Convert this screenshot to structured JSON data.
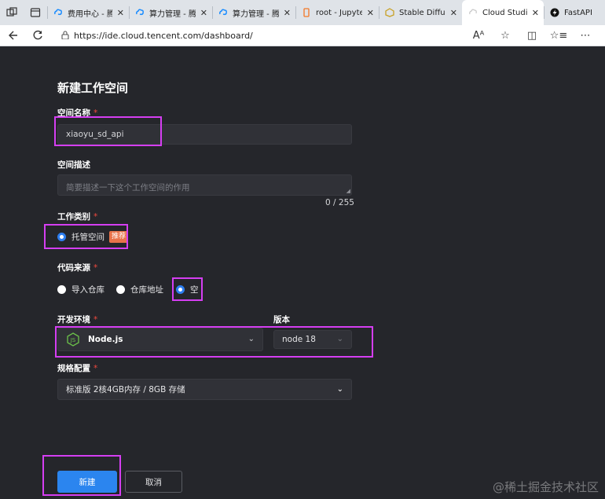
{
  "browser": {
    "tabs": [
      {
        "title": "费用中心 - 腾",
        "icon": "cloud-icon",
        "active": false
      },
      {
        "title": "算力管理 - 腾",
        "icon": "cloud-icon",
        "active": false
      },
      {
        "title": "算力管理 - 腾",
        "icon": "cloud-icon",
        "active": false
      },
      {
        "title": "root - Jupyte",
        "icon": "jupyter-icon",
        "active": false
      },
      {
        "title": "Stable Diffusi",
        "icon": "stable-diffusion-icon",
        "active": false
      },
      {
        "title": "Cloud Studio",
        "icon": "cloud-studio-icon",
        "active": true
      },
      {
        "title": "FastAPI - S",
        "icon": "fastapi-icon",
        "active": false
      }
    ],
    "url": "https://ide.cloud.tencent.com/dashboard/"
  },
  "form": {
    "title": "新建工作空间",
    "name": {
      "label": "空间名称",
      "value": "xiaoyu_sd_api"
    },
    "description": {
      "label": "空间描述",
      "placeholder": "简要描述一下这个工作空间的作用",
      "counter": "0 / 255"
    },
    "workspace_type": {
      "label": "工作类别",
      "option": "托管空间",
      "badge": "推荐"
    },
    "code_source": {
      "label": "代码来源",
      "options": [
        {
          "label": "导入仓库",
          "selected": false
        },
        {
          "label": "仓库地址",
          "selected": false
        },
        {
          "label": "空",
          "selected": true
        }
      ]
    },
    "dev_env": {
      "label": "开发环境",
      "value": "Node.js"
    },
    "version": {
      "label": "版本",
      "value": "node 18"
    },
    "spec": {
      "label": "规格配置",
      "value": "标准版 2核4GB内存 / 8GB 存储"
    },
    "create_button": "新建",
    "cancel_button": "取消"
  },
  "colors": {
    "accent": "#2b85ef",
    "highlight": "#d53ef2",
    "required": "#f0493e",
    "badge": "#e8734a"
  },
  "watermark": "@稀土掘金技术社区"
}
